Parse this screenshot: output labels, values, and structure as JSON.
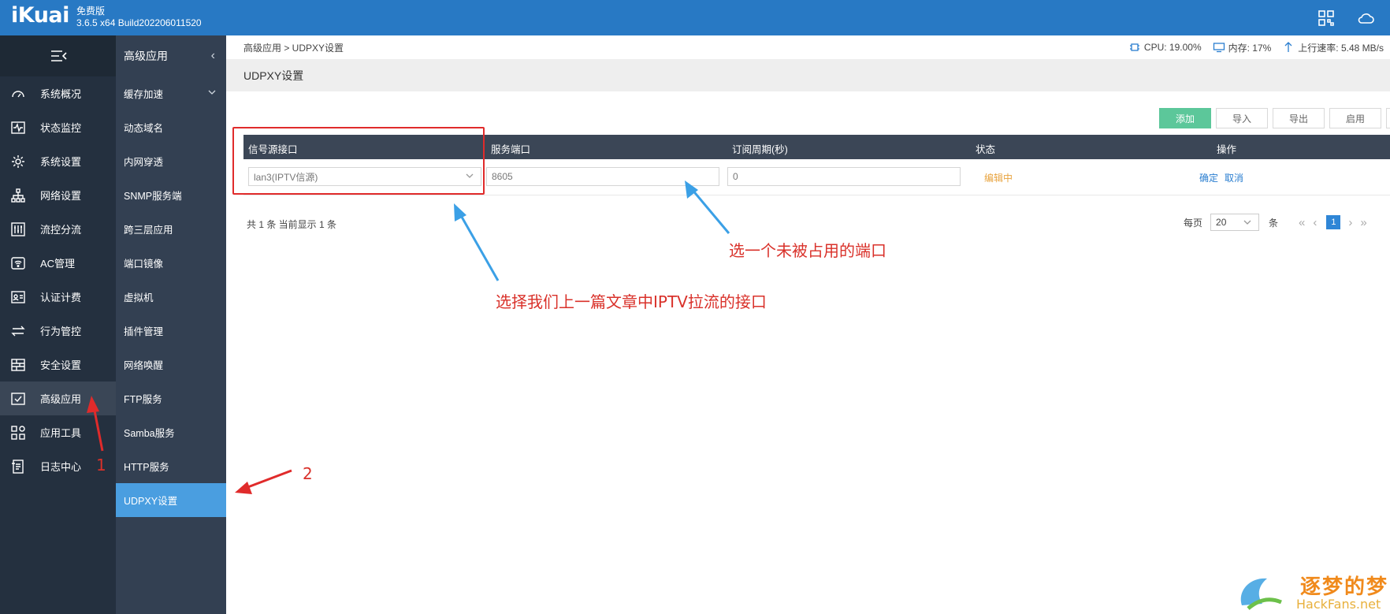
{
  "app": {
    "logo": "iKuai",
    "edition": "免费版",
    "build": "3.6.5 x64 Build202206011520"
  },
  "breadcrumb": "高级应用 > UDPXY设置",
  "stats": {
    "cpu": "CPU: 19.00%",
    "memory": "内存: 17%",
    "upload": "上行速率: 5.48 MB/s"
  },
  "page_title": "UDPXY设置",
  "sidebar": {
    "items": [
      {
        "label": "系统概况",
        "icon": "gauge-icon"
      },
      {
        "label": "状态监控",
        "icon": "pulse-icon"
      },
      {
        "label": "系统设置",
        "icon": "gear-icon"
      },
      {
        "label": "网络设置",
        "icon": "network-icon"
      },
      {
        "label": "流控分流",
        "icon": "sliders-icon"
      },
      {
        "label": "AC管理",
        "icon": "wifi-icon"
      },
      {
        "label": "认证计费",
        "icon": "id-card-icon"
      },
      {
        "label": "行为管控",
        "icon": "arrows-icon"
      },
      {
        "label": "安全设置",
        "icon": "firewall-icon"
      },
      {
        "label": "高级应用",
        "icon": "app-check-icon",
        "active": true
      },
      {
        "label": "应用工具",
        "icon": "tools-grid-icon"
      },
      {
        "label": "日志中心",
        "icon": "log-icon"
      }
    ]
  },
  "subnav": {
    "title": "高级应用",
    "items": [
      {
        "label": "缓存加速",
        "expandable": true
      },
      {
        "label": "动态域名"
      },
      {
        "label": "内网穿透"
      },
      {
        "label": "SNMP服务端"
      },
      {
        "label": "跨三层应用"
      },
      {
        "label": "端口镜像"
      },
      {
        "label": "虚拟机"
      },
      {
        "label": "插件管理"
      },
      {
        "label": "网络唤醒"
      },
      {
        "label": "FTP服务"
      },
      {
        "label": "Samba服务"
      },
      {
        "label": "HTTP服务"
      },
      {
        "label": "UDPXY设置",
        "active": true
      }
    ]
  },
  "toolbar": {
    "add": "添加",
    "import": "导入",
    "export": "导出",
    "enable": "启用"
  },
  "table": {
    "columns": [
      "信号源接口",
      "服务端口",
      "订阅周期(秒)",
      "状态",
      "操作"
    ],
    "row": {
      "interface": "lan3(IPTV信源)",
      "port": "8605",
      "period": "0",
      "status": "编辑中",
      "confirm": "确定",
      "cancel": "取消"
    }
  },
  "footer": {
    "summary": "共 1 条 当前显示 1 条",
    "per_page_label": "每页",
    "per_page": "20",
    "unit": "条",
    "current_page": "1"
  },
  "annotations": {
    "port_note": "选一个未被占用的端口",
    "interface_note": "选择我们上一篇文章中IPTV拉流的接口",
    "step1": "1",
    "step2": "2"
  },
  "watermark": {
    "title": "逐梦的梦",
    "site": "HackFans.net"
  },
  "colors": {
    "topbar": "#2879c4",
    "sidebar": "#24303f",
    "subnav": "#334052",
    "active": "#4a9ee0",
    "primary_button": "#5cc79a",
    "annotation_red": "#d9312a",
    "annotation_blue": "#3ba0e6"
  }
}
